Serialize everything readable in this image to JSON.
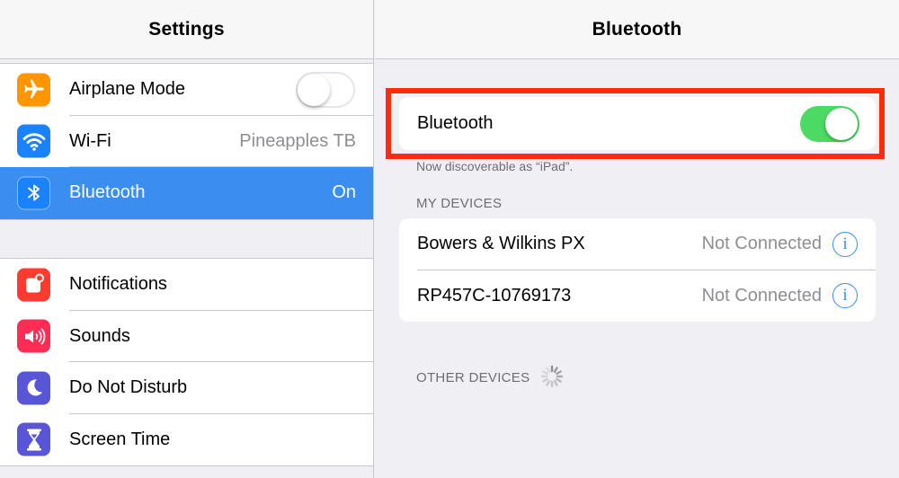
{
  "settings": {
    "title": "Settings",
    "group1": [
      {
        "label": "Airplane Mode",
        "icon": "airplane-icon",
        "color": "#ff9500",
        "toggle": "off"
      },
      {
        "label": "Wi-Fi",
        "icon": "wifi-icon",
        "color": "#1a82fb",
        "value": "Pineapples TB"
      },
      {
        "label": "Bluetooth",
        "icon": "bluetooth-icon",
        "color": "#1a82fb",
        "value": "On",
        "selected": true
      }
    ],
    "group2": [
      {
        "label": "Notifications",
        "icon": "notifications-icon",
        "color": "#ff3b30"
      },
      {
        "label": "Sounds",
        "icon": "sounds-icon",
        "color": "#ff2d55"
      },
      {
        "label": "Do Not Disturb",
        "icon": "moon-icon",
        "color": "#5856d6"
      },
      {
        "label": "Screen Time",
        "icon": "hourglass-icon",
        "color": "#5856d6"
      }
    ]
  },
  "bluetooth": {
    "title": "Bluetooth",
    "toggle_label": "Bluetooth",
    "toggle_state": "on",
    "discoverable_note": "Now discoverable as “iPad”.",
    "my_devices_header": "MY DEVICES",
    "devices": [
      {
        "name": "Bowers & Wilkins PX",
        "status": "Not Connected"
      },
      {
        "name": "RP457C-10769173",
        "status": "Not Connected"
      }
    ],
    "other_devices_header": "OTHER DEVICES"
  },
  "colors": {
    "accent": "#3a8ef0",
    "switch_on": "#4cd964",
    "highlight": "#ff2a12"
  }
}
